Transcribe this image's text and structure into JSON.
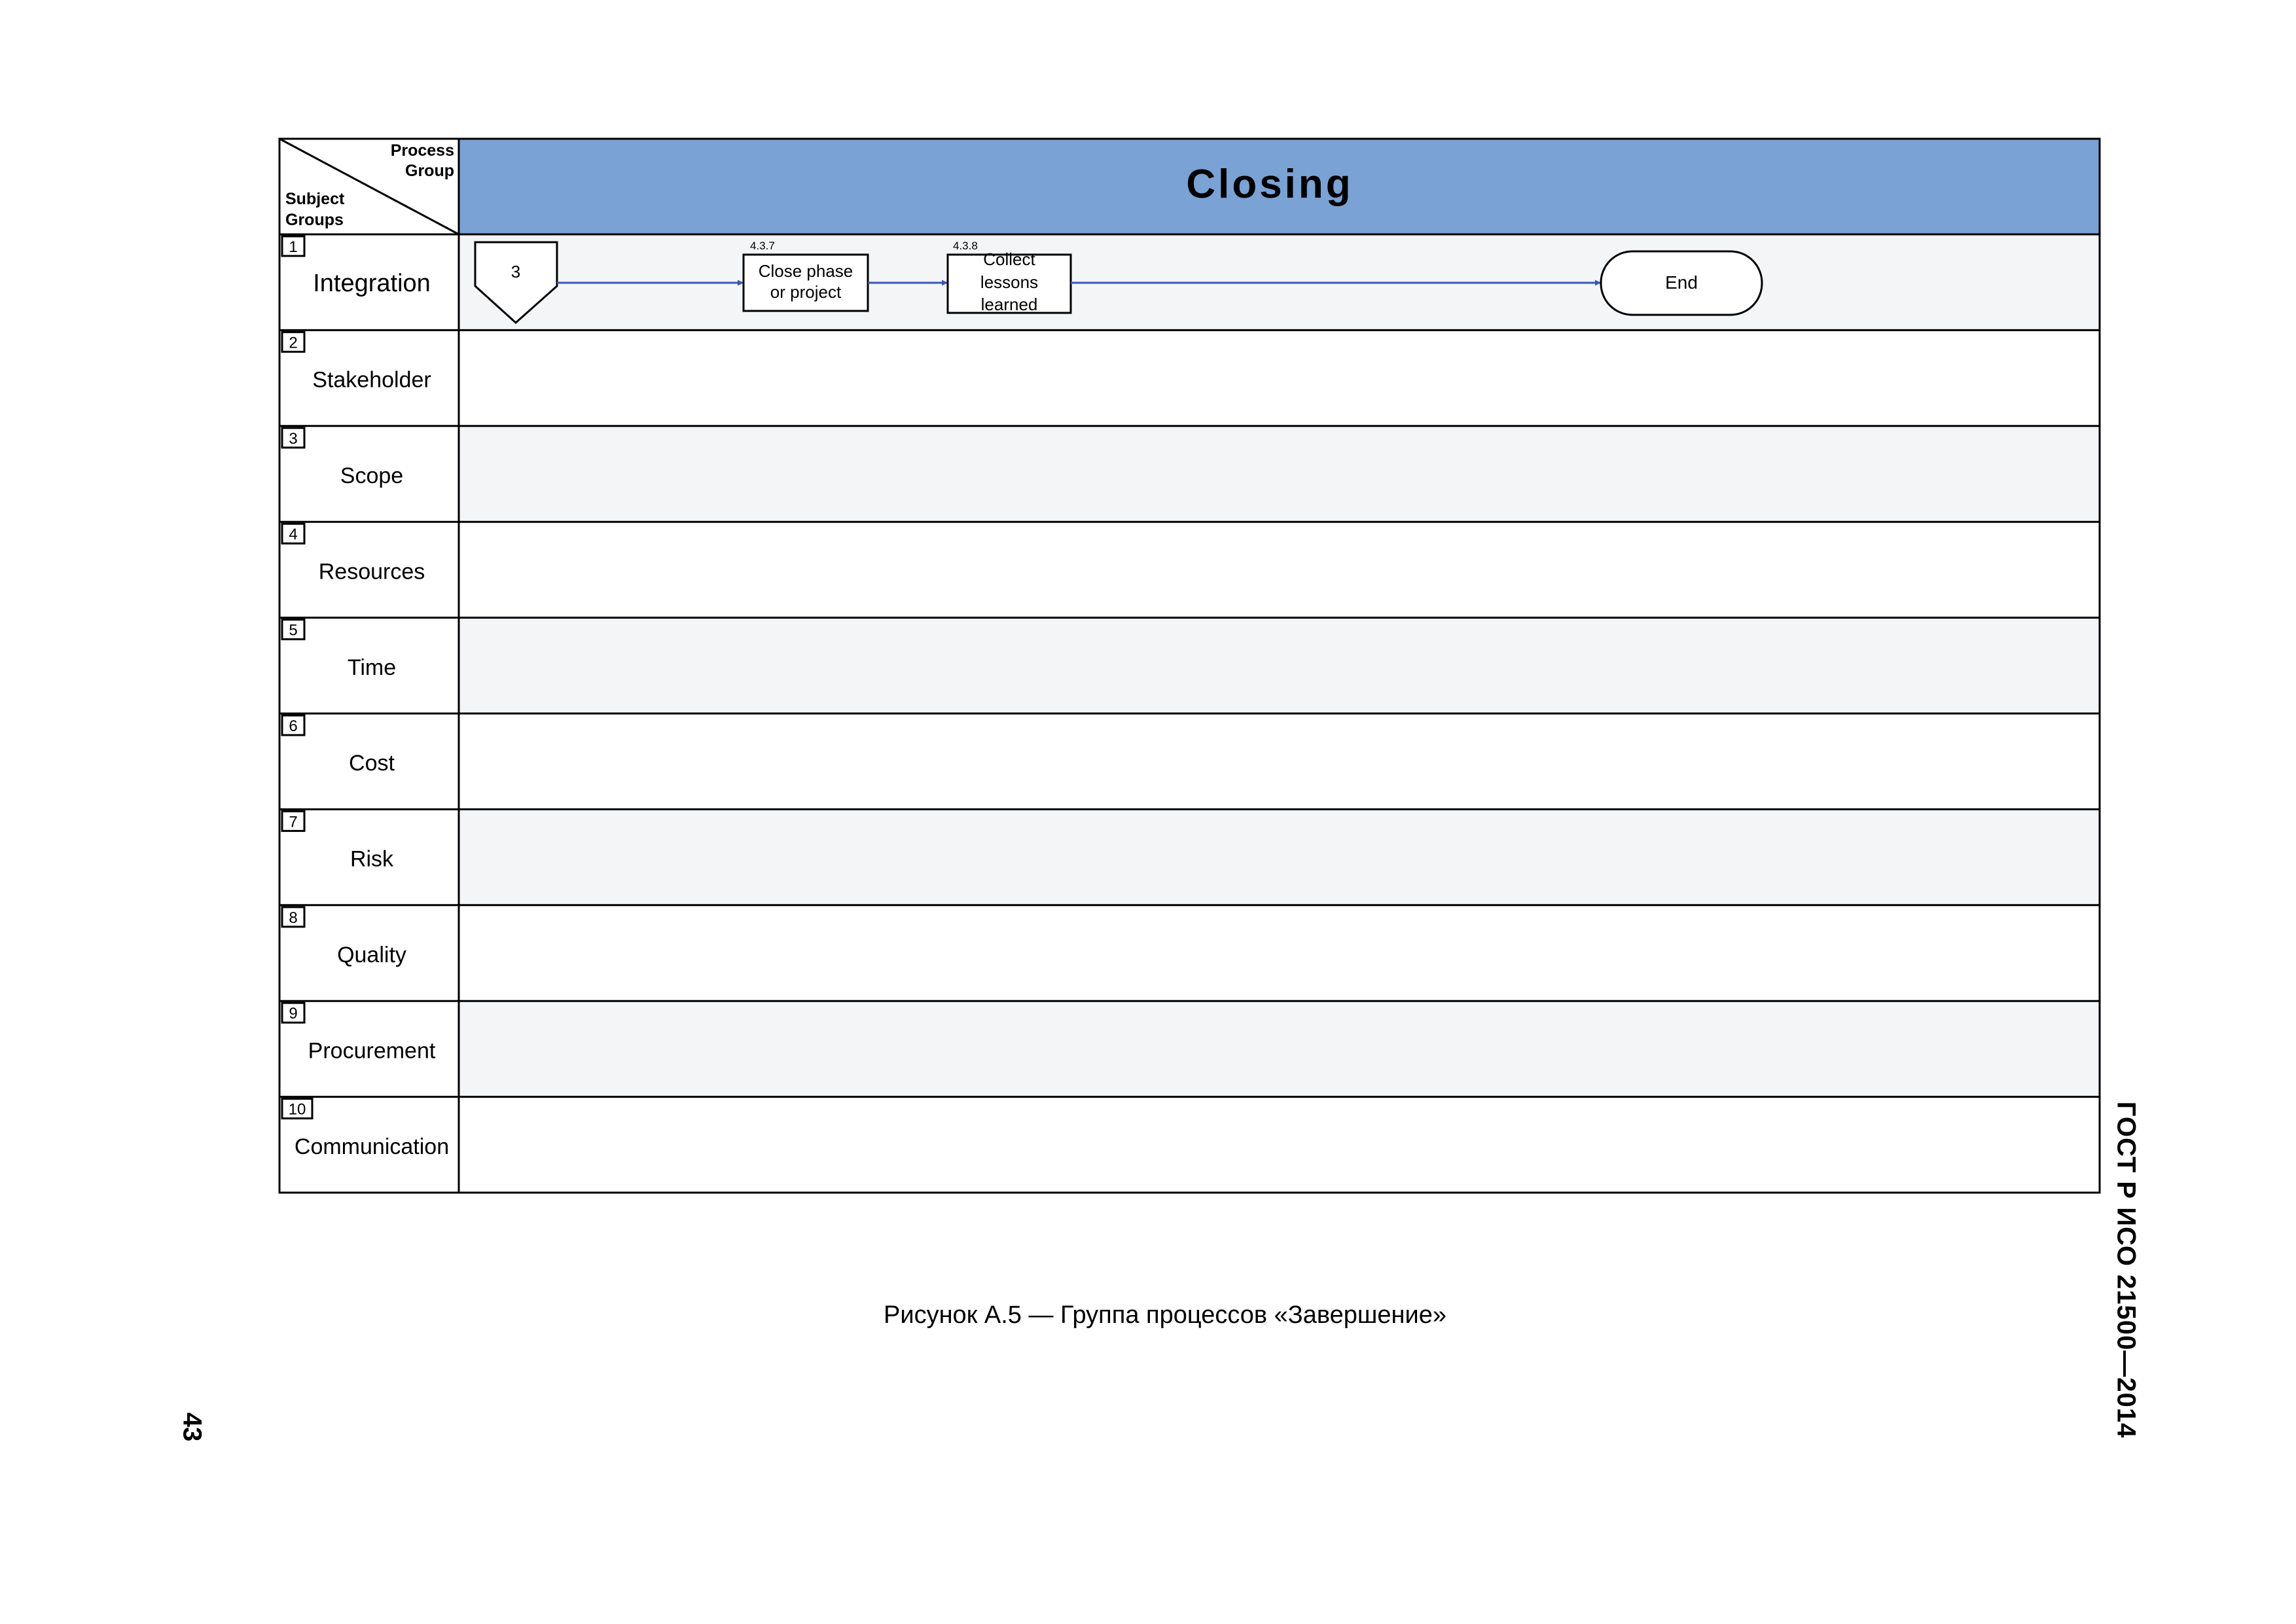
{
  "header": {
    "corner_top": [
      "Process",
      "Group"
    ],
    "corner_bottom": [
      "Subject",
      "Groups"
    ],
    "title": "Closing",
    "color": "#7aa2d4"
  },
  "subject_groups": [
    {
      "number": "1",
      "label": "Integration"
    },
    {
      "number": "2",
      "label": "Stakeholder"
    },
    {
      "number": "3",
      "label": "Scope"
    },
    {
      "number": "4",
      "label": "Resources"
    },
    {
      "number": "5",
      "label": "Time"
    },
    {
      "number": "6",
      "label": "Cost"
    },
    {
      "number": "7",
      "label": "Risk"
    },
    {
      "number": "8",
      "label": "Quality"
    },
    {
      "number": "9",
      "label": "Procurement"
    },
    {
      "number": "10",
      "label": "Communication"
    }
  ],
  "flow": {
    "connector": "3",
    "processes": [
      {
        "ref": "4.3.7",
        "lines": [
          "Close phase",
          "or project"
        ]
      },
      {
        "ref": "4.3.8",
        "lines": [
          "Collect",
          "lessons",
          "learned"
        ]
      }
    ],
    "terminator": "End",
    "arrow_color": "#3a56b4"
  },
  "caption": "Рисунок А.5 — Группа процессов «Завершение»",
  "standard_code": "ГОСТ Р ИСО 21500—2014",
  "page_number": "43"
}
